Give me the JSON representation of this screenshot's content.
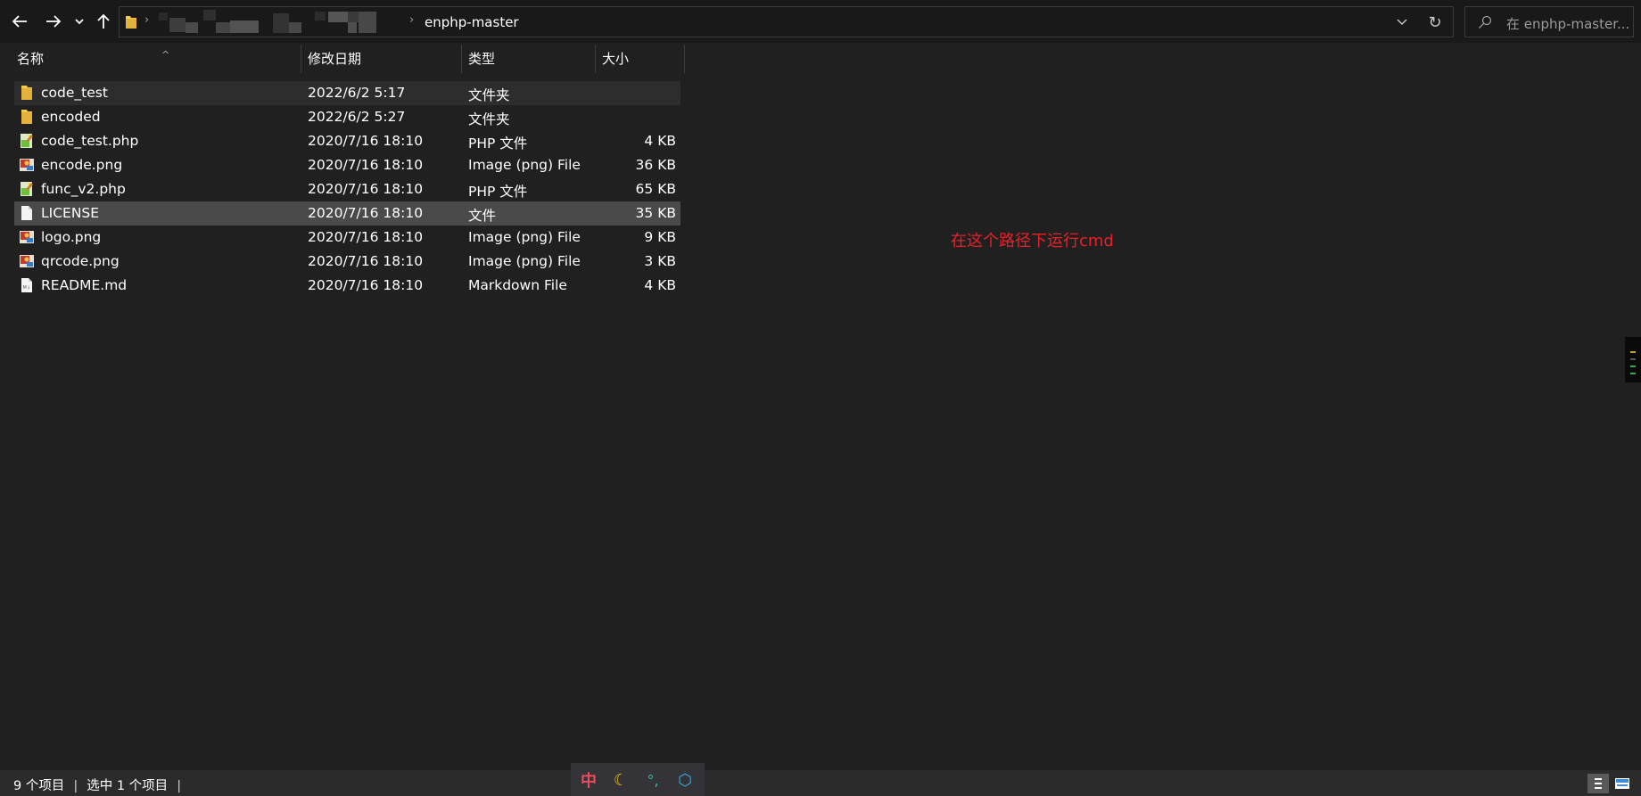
{
  "nav": {
    "back_icon": "arrow-left-icon",
    "forward_icon": "arrow-right-icon",
    "recent_icon": "chevron-down-icon",
    "up_icon": "arrow-up-icon"
  },
  "address": {
    "separator": "›",
    "current_folder": "enphp-master",
    "dropdown_glyph": "⌄",
    "refresh_glyph": "↻"
  },
  "search": {
    "placeholder": "在 enphp-master..."
  },
  "columns": {
    "name": "名称",
    "date": "修改日期",
    "type": "类型",
    "size": "大小",
    "sort_glyph": "^"
  },
  "files": [
    {
      "name": "code_test",
      "date": "2022/6/2 5:17",
      "type": "文件夹",
      "size": "",
      "icon": "folder-icon"
    },
    {
      "name": "encoded",
      "date": "2022/6/2 5:27",
      "type": "文件夹",
      "size": "",
      "icon": "folder-icon"
    },
    {
      "name": "code_test.php",
      "date": "2020/7/16 18:10",
      "type": "PHP 文件",
      "size": "4 KB",
      "icon": "php-file-icon"
    },
    {
      "name": "encode.png",
      "date": "2020/7/16 18:10",
      "type": "Image (png) File",
      "size": "36 KB",
      "icon": "image-file-icon"
    },
    {
      "name": "func_v2.php",
      "date": "2020/7/16 18:10",
      "type": "PHP 文件",
      "size": "65 KB",
      "icon": "php-file-icon"
    },
    {
      "name": "LICENSE",
      "date": "2020/7/16 18:10",
      "type": "文件",
      "size": "35 KB",
      "icon": "blank-file-icon"
    },
    {
      "name": "logo.png",
      "date": "2020/7/16 18:10",
      "type": "Image (png) File",
      "size": "9 KB",
      "icon": "image-file-icon"
    },
    {
      "name": "qrcode.png",
      "date": "2020/7/16 18:10",
      "type": "Image (png) File",
      "size": "3 KB",
      "icon": "image-file-icon"
    },
    {
      "name": "README.md",
      "date": "2020/7/16 18:10",
      "type": "Markdown File",
      "size": "4 KB",
      "icon": "markdown-file-icon"
    }
  ],
  "annotation": "在这个路径下运行cmd",
  "status": {
    "item_count": "9 个项目",
    "selected": "选中 1 个项目",
    "separator": "|"
  },
  "ime": {
    "lang": "中",
    "moon": "☾",
    "punc": "°,",
    "gear": "⬡"
  },
  "colors": {
    "background": "#202020",
    "topbar": "#191919",
    "selected_row": "#4a4a4a",
    "hover_row": "#2d2d2d",
    "annotation": "#e8202a",
    "folder": "#f5c94a"
  }
}
